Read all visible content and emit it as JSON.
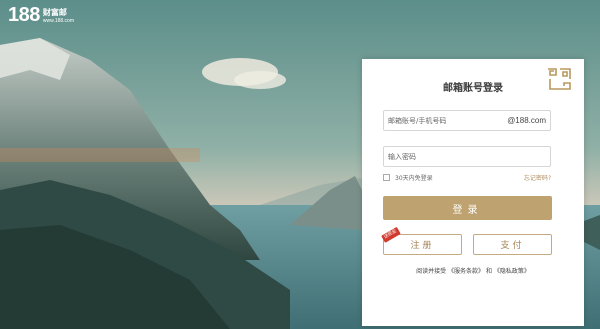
{
  "brand": {
    "number": "188",
    "name": "财富邮",
    "site": "www.188.com"
  },
  "login": {
    "title": "邮箱账号登录",
    "account_placeholder": "邮箱账号/手机号码",
    "domain_suffix": "@188.com",
    "password_placeholder": "输入密码",
    "remember_label": "30天内免登录",
    "forgot_label": "忘记密码?",
    "login_button": "登录",
    "register_button": "注册",
    "register_badge": "送现金",
    "pay_button": "支付",
    "terms_prefix": "阅读并接受",
    "terms_service": "《服务条款》",
    "terms_and": "和",
    "terms_privacy": "《隐私政策》"
  },
  "colors": {
    "accent": "#bea26f",
    "accent_text": "#a58354",
    "badge": "#d13b2f"
  },
  "icons": {
    "corner": "decorative-corner-pattern-icon",
    "side": "refresh-icon"
  }
}
